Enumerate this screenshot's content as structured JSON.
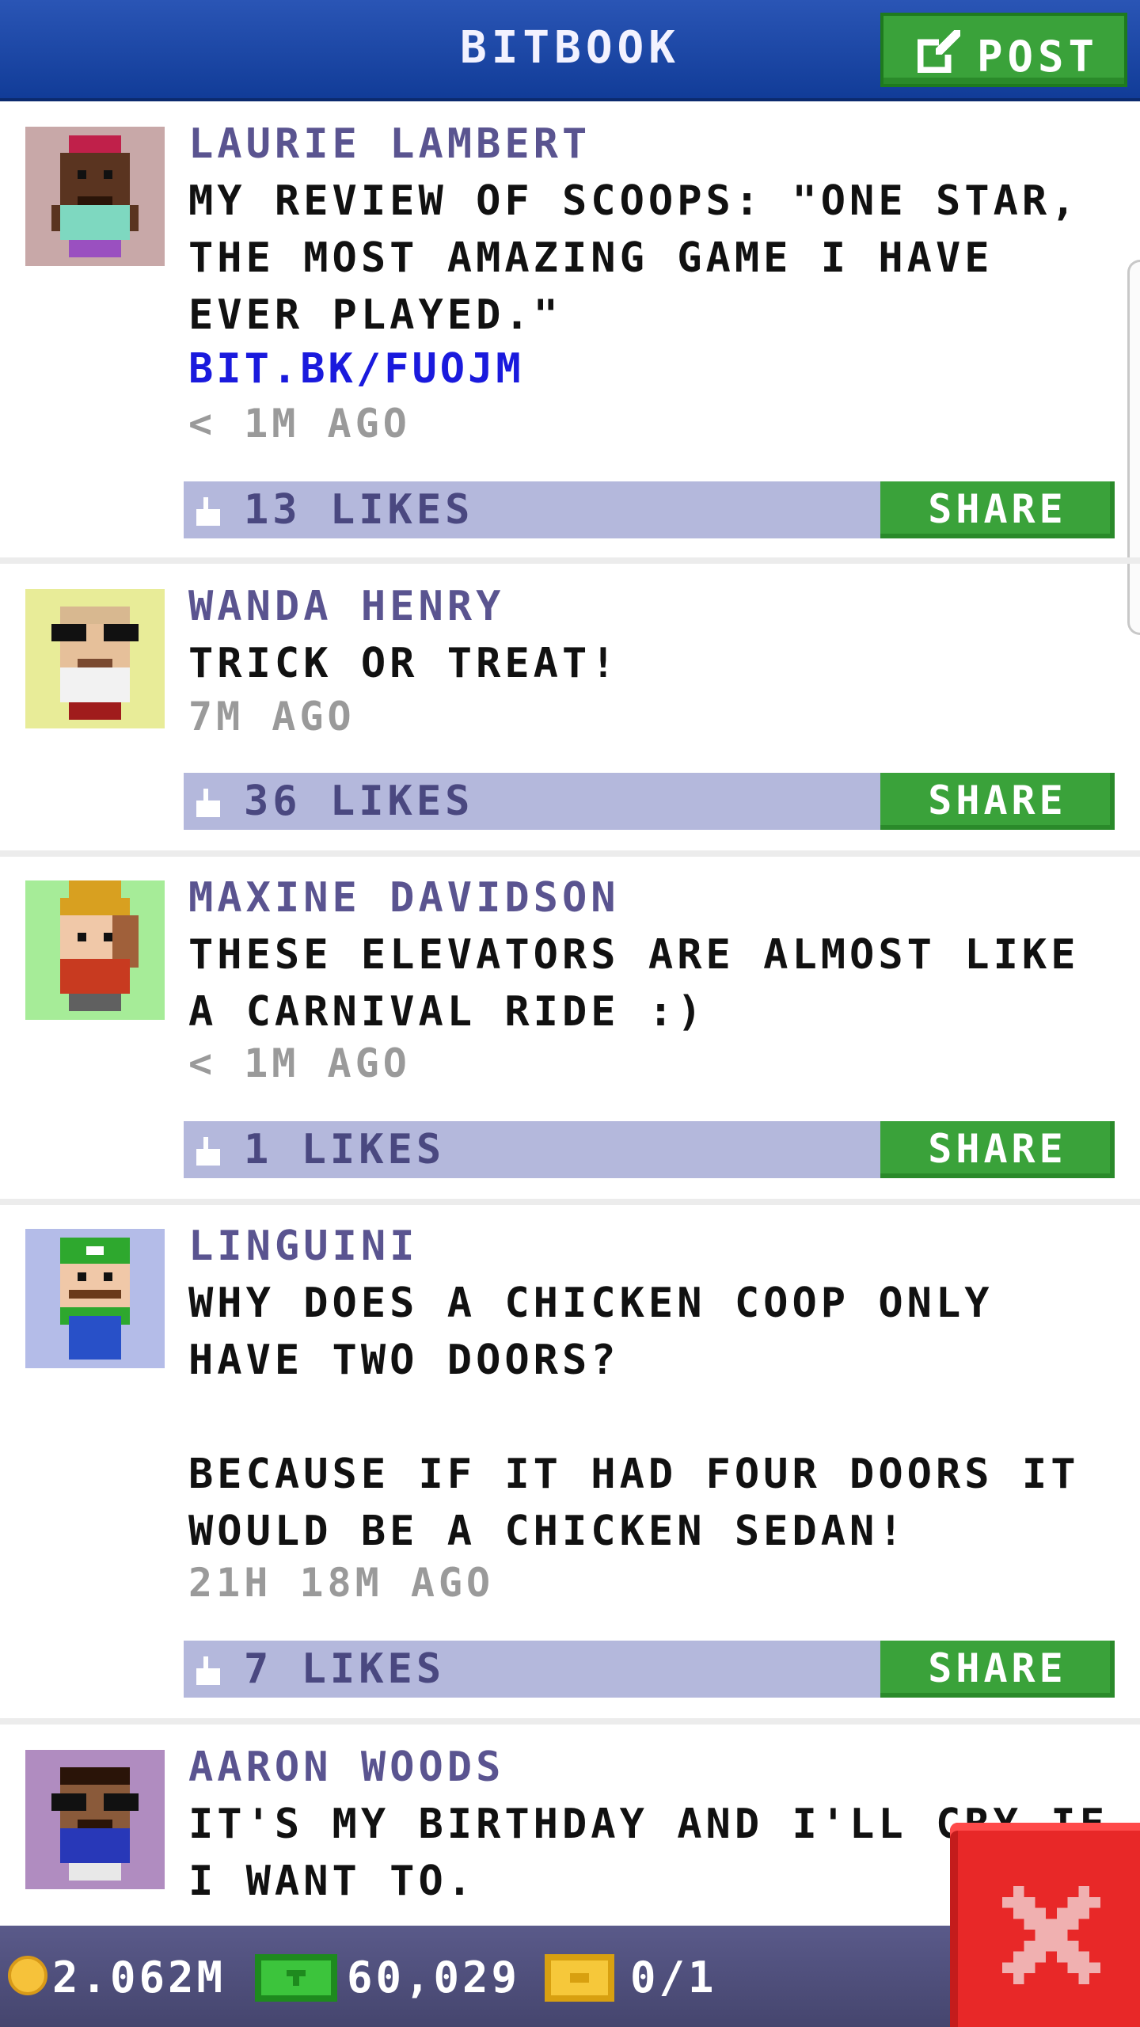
{
  "header": {
    "title": "BITBOOK",
    "post_label": "POST"
  },
  "posts": [
    {
      "author": "LAURIE LAMBERT",
      "message": "MY REVIEW OF SCOOPS: \"ONE STAR, THE MOST AMAZING GAME I HAVE EVER PLAYED.\"",
      "link": "BIT.BK/FUOJM",
      "time": "< 1M AGO",
      "likes": "13 LIKES",
      "share": "SHARE",
      "avatar_bg": "#c8a8a8"
    },
    {
      "author": "WANDA HENRY",
      "message": "TRICK OR TREAT!",
      "time": "7M AGO",
      "likes": "36 LIKES",
      "share": "SHARE",
      "avatar_bg": "#e8ec98"
    },
    {
      "author": "MAXINE DAVIDSON",
      "message": "THESE ELEVATORS ARE ALMOST LIKE A CARNIVAL RIDE :)",
      "time": "< 1M AGO",
      "likes": "1 LIKES",
      "share": "SHARE",
      "avatar_bg": "#a6ec98"
    },
    {
      "author": "LINGUINI",
      "message": "WHY DOES A CHICKEN COOP ONLY HAVE TWO DOORS?\n\nBECAUSE IF IT HAD FOUR DOORS IT WOULD BE A CHICKEN SEDAN!",
      "time": "21H 18M AGO",
      "likes": "7 LIKES",
      "share": "SHARE",
      "avatar_bg": "#b4bce8"
    },
    {
      "author": "AARON WOODS",
      "message": "IT'S MY BIRTHDAY AND I'LL CRY IF I WANT TO.",
      "avatar_bg": "#b08cc0"
    }
  ],
  "footer": {
    "coins": "2.062M",
    "cash": "60,029",
    "tickets": "0/1"
  },
  "colors": {
    "header": "#1a46a8",
    "accent_green": "#3aa23a",
    "like_bar": "#b4b8dc",
    "close_red": "#e82828"
  },
  "icons": {
    "post": "edit-icon",
    "like": "thumbs-up-icon",
    "coin": "coin-icon",
    "cash": "cash-icon",
    "ticket": "ticket-icon",
    "close": "close-icon"
  }
}
